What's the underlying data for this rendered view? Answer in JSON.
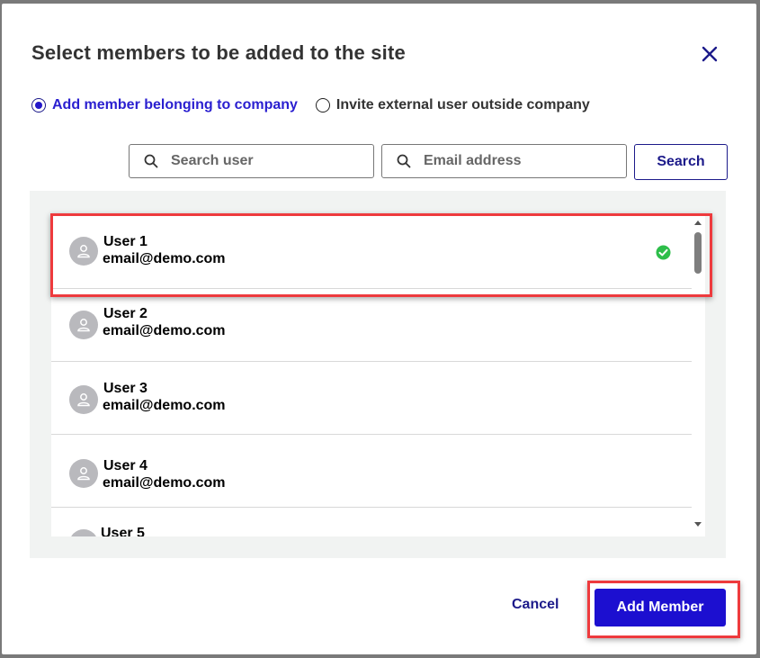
{
  "dialog": {
    "title": "Select members to be added to the site",
    "close_icon": "close-icon"
  },
  "member_type": {
    "options": [
      {
        "label": "Add member belonging to company",
        "selected": true
      },
      {
        "label": "Invite external user outside company",
        "selected": false
      }
    ]
  },
  "search": {
    "user_placeholder": "Search user",
    "user_value": "",
    "email_placeholder": "Email address",
    "email_value": "",
    "button_label": "Search"
  },
  "users": [
    {
      "name": "User 1",
      "email": "email@demo.com",
      "selected": true
    },
    {
      "name": "User 2",
      "email": "email@demo.com",
      "selected": false
    },
    {
      "name": "User 3",
      "email": "email@demo.com",
      "selected": false
    },
    {
      "name": "User 4",
      "email": "email@demo.com",
      "selected": false
    },
    {
      "name": "User 5",
      "email": "",
      "selected": false
    }
  ],
  "footer": {
    "cancel_label": "Cancel",
    "add_label": "Add Member"
  },
  "colors": {
    "accent": "#1c0fd0",
    "highlight": "#ee3a3d",
    "check": "#2dbe4a"
  }
}
